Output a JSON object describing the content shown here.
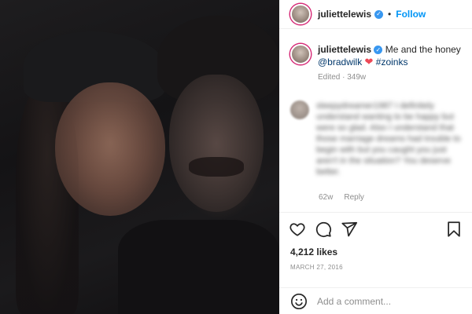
{
  "post": {
    "username": "juliettelewis",
    "follow_label": "Follow",
    "header_separator": "•",
    "more_icon": "ellipsis-icon",
    "caption": {
      "text_before": "Me and the honey",
      "mention": "@bradwilk",
      "heart": "❤",
      "hashtag": "#zoinks",
      "meta": "Edited · 349w"
    },
    "comment": {
      "username": "sleepydreamer1987",
      "text": "I definitely understand wanting to be happy but were so glad. Also I understand that those marriage dreams had trouble to begin with but you caught you just aren't in the situation? You deserve better.",
      "age": "62w",
      "reply_label": "Reply"
    },
    "likes": "4,212 likes",
    "date": "MARCH 27, 2016",
    "add_comment_placeholder": "Add a comment..."
  },
  "colors": {
    "accent": "#0095f6",
    "link": "#00376b",
    "heart": "#ed4956",
    "verified": "#3897f0",
    "muted": "#8e8e8e"
  }
}
